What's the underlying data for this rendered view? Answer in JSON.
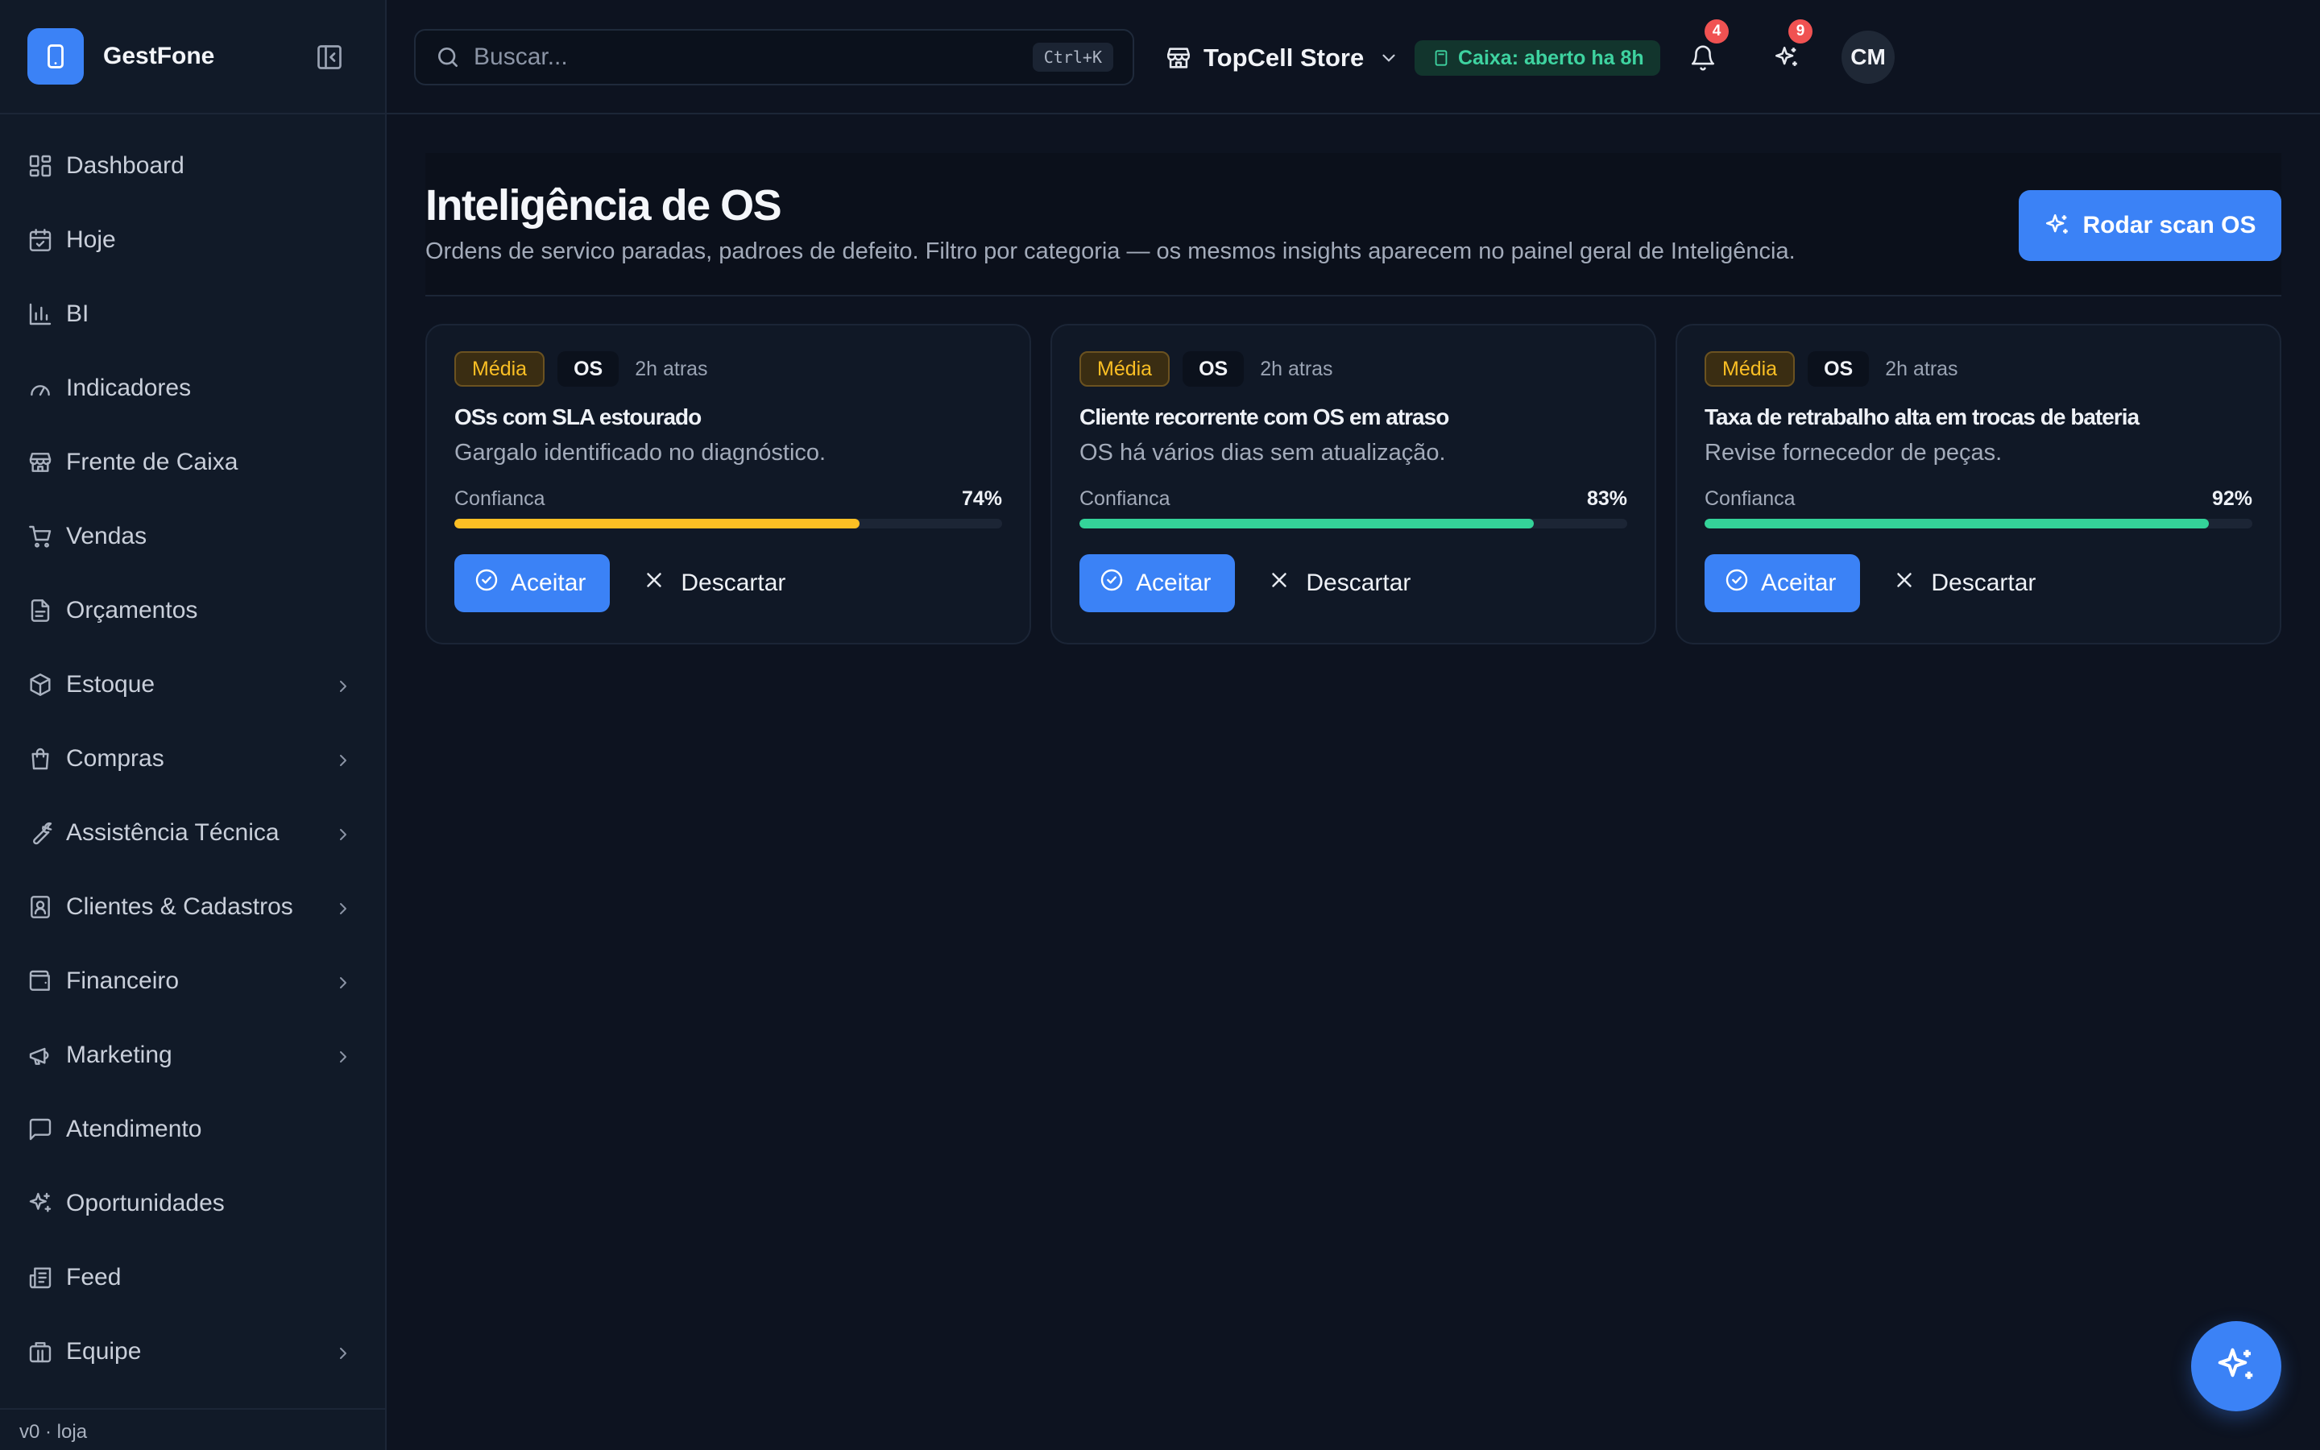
{
  "brand": {
    "name": "GestFone"
  },
  "sidebar": {
    "items": [
      {
        "label": "Dashboard",
        "icon": "dashboard-icon",
        "expandable": false
      },
      {
        "label": "Hoje",
        "icon": "calendar-icon",
        "expandable": false
      },
      {
        "label": "BI",
        "icon": "bar-chart-icon",
        "expandable": false
      },
      {
        "label": "Indicadores",
        "icon": "gauge-icon",
        "expandable": false
      },
      {
        "label": "Frente de Caixa",
        "icon": "store-icon",
        "expandable": false
      },
      {
        "label": "Vendas",
        "icon": "cart-icon",
        "expandable": false
      },
      {
        "label": "Orçamentos",
        "icon": "document-icon",
        "expandable": false
      },
      {
        "label": "Estoque",
        "icon": "package-icon",
        "expandable": true
      },
      {
        "label": "Compras",
        "icon": "shopping-bag-icon",
        "expandable": true
      },
      {
        "label": "Assistência Técnica",
        "icon": "wrench-icon",
        "expandable": true
      },
      {
        "label": "Clientes & Cadastros",
        "icon": "contact-icon",
        "expandable": true
      },
      {
        "label": "Financeiro",
        "icon": "wallet-icon",
        "expandable": true
      },
      {
        "label": "Marketing",
        "icon": "megaphone-icon",
        "expandable": true
      },
      {
        "label": "Atendimento",
        "icon": "chat-icon",
        "expandable": false
      },
      {
        "label": "Oportunidades",
        "icon": "sparkles-icon",
        "expandable": false
      },
      {
        "label": "Feed",
        "icon": "newspaper-icon",
        "expandable": false
      },
      {
        "label": "Equipe",
        "icon": "building-icon",
        "expandable": true
      }
    ],
    "footer": "v0 · loja"
  },
  "topbar": {
    "search_placeholder": "Buscar...",
    "search_shortcut": "Ctrl+K",
    "store_name": "TopCell Store",
    "cash_status": "Caixa: aberto ha 8h",
    "notifications_count": "4",
    "insights_count": "9",
    "avatar_initials": "CM"
  },
  "page": {
    "title": "Inteligência de OS",
    "subtitle": "Ordens de servico paradas, padroes de defeito. Filtro por categoria — os mesmos insights aparecem no painel geral de Inteligência.",
    "scan_button": "Rodar scan OS"
  },
  "cards": [
    {
      "severity": "Média",
      "category": "OS",
      "time": "2h atras",
      "title": "OSs com SLA estourado",
      "description": "Gargalo identificado no diagnóstico.",
      "confidence_label": "Confianca",
      "confidence_text": "74%",
      "confidence": 0.74,
      "bar_color": "#fbbf24",
      "accept": "Aceitar",
      "discard": "Descartar"
    },
    {
      "severity": "Média",
      "category": "OS",
      "time": "2h atras",
      "title": "Cliente recorrente com OS em atraso",
      "description": "OS há vários dias sem atualização.",
      "confidence_label": "Confianca",
      "confidence_text": "83%",
      "confidence": 0.83,
      "bar_color": "#34d399",
      "accept": "Aceitar",
      "discard": "Descartar"
    },
    {
      "severity": "Média",
      "category": "OS",
      "time": "2h atras",
      "title": "Taxa de retrabalho alta em trocas de bateria",
      "description": "Revise fornecedor de peças.",
      "confidence_label": "Confianca",
      "confidence_text": "92%",
      "confidence": 0.92,
      "bar_color": "#34d399",
      "accept": "Aceitar",
      "discard": "Descartar"
    }
  ],
  "colors": {
    "accent": "#3b82f6",
    "background": "#0d1320",
    "sidebar": "#111a28",
    "warning": "#fbbf24",
    "success": "#34d399",
    "badge": "#f05252"
  }
}
